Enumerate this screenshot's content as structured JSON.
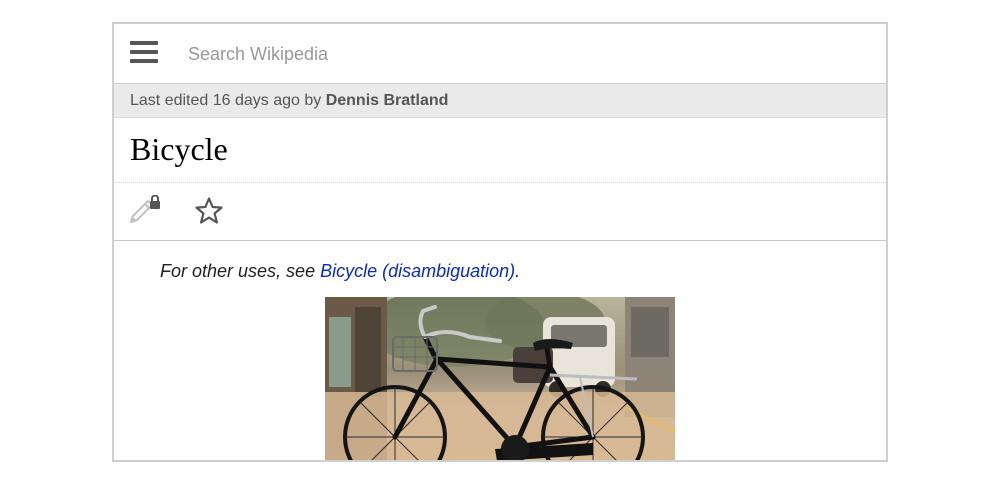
{
  "search": {
    "placeholder": "Search Wikipedia"
  },
  "last_edited": {
    "prefix": "Last edited 16 days ago by ",
    "editor": "Dennis Bratland"
  },
  "page": {
    "title": "Bicycle"
  },
  "hatnote": {
    "prefix": "For other uses, see ",
    "link_text": "Bicycle (disambiguation)",
    "suffix": "."
  },
  "icons": {
    "menu": "menu-icon",
    "edit": "pencil-lock-icon",
    "watch": "star-icon"
  },
  "colors": {
    "link": "#0b29c9",
    "header_border": "#cfcfcf",
    "last_edited_bg": "#eaeaea"
  }
}
